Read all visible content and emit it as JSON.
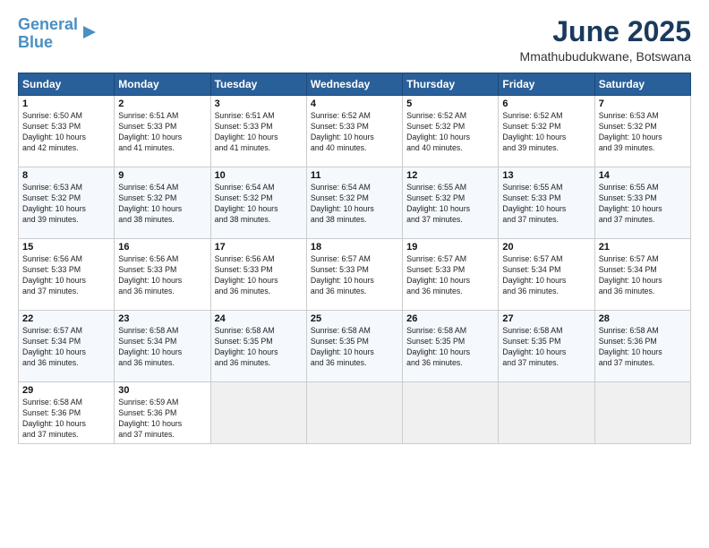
{
  "logo": {
    "line1": "General",
    "line2": "Blue"
  },
  "title": "June 2025",
  "subtitle": "Mmathubudukwane, Botswana",
  "headers": [
    "Sunday",
    "Monday",
    "Tuesday",
    "Wednesday",
    "Thursday",
    "Friday",
    "Saturday"
  ],
  "weeks": [
    [
      {
        "day": "1",
        "info": "Sunrise: 6:50 AM\nSunset: 5:33 PM\nDaylight: 10 hours\nand 42 minutes."
      },
      {
        "day": "2",
        "info": "Sunrise: 6:51 AM\nSunset: 5:33 PM\nDaylight: 10 hours\nand 41 minutes."
      },
      {
        "day": "3",
        "info": "Sunrise: 6:51 AM\nSunset: 5:33 PM\nDaylight: 10 hours\nand 41 minutes."
      },
      {
        "day": "4",
        "info": "Sunrise: 6:52 AM\nSunset: 5:33 PM\nDaylight: 10 hours\nand 40 minutes."
      },
      {
        "day": "5",
        "info": "Sunrise: 6:52 AM\nSunset: 5:32 PM\nDaylight: 10 hours\nand 40 minutes."
      },
      {
        "day": "6",
        "info": "Sunrise: 6:52 AM\nSunset: 5:32 PM\nDaylight: 10 hours\nand 39 minutes."
      },
      {
        "day": "7",
        "info": "Sunrise: 6:53 AM\nSunset: 5:32 PM\nDaylight: 10 hours\nand 39 minutes."
      }
    ],
    [
      {
        "day": "8",
        "info": "Sunrise: 6:53 AM\nSunset: 5:32 PM\nDaylight: 10 hours\nand 39 minutes."
      },
      {
        "day": "9",
        "info": "Sunrise: 6:54 AM\nSunset: 5:32 PM\nDaylight: 10 hours\nand 38 minutes."
      },
      {
        "day": "10",
        "info": "Sunrise: 6:54 AM\nSunset: 5:32 PM\nDaylight: 10 hours\nand 38 minutes."
      },
      {
        "day": "11",
        "info": "Sunrise: 6:54 AM\nSunset: 5:32 PM\nDaylight: 10 hours\nand 38 minutes."
      },
      {
        "day": "12",
        "info": "Sunrise: 6:55 AM\nSunset: 5:32 PM\nDaylight: 10 hours\nand 37 minutes."
      },
      {
        "day": "13",
        "info": "Sunrise: 6:55 AM\nSunset: 5:33 PM\nDaylight: 10 hours\nand 37 minutes."
      },
      {
        "day": "14",
        "info": "Sunrise: 6:55 AM\nSunset: 5:33 PM\nDaylight: 10 hours\nand 37 minutes."
      }
    ],
    [
      {
        "day": "15",
        "info": "Sunrise: 6:56 AM\nSunset: 5:33 PM\nDaylight: 10 hours\nand 37 minutes."
      },
      {
        "day": "16",
        "info": "Sunrise: 6:56 AM\nSunset: 5:33 PM\nDaylight: 10 hours\nand 36 minutes."
      },
      {
        "day": "17",
        "info": "Sunrise: 6:56 AM\nSunset: 5:33 PM\nDaylight: 10 hours\nand 36 minutes."
      },
      {
        "day": "18",
        "info": "Sunrise: 6:57 AM\nSunset: 5:33 PM\nDaylight: 10 hours\nand 36 minutes."
      },
      {
        "day": "19",
        "info": "Sunrise: 6:57 AM\nSunset: 5:33 PM\nDaylight: 10 hours\nand 36 minutes."
      },
      {
        "day": "20",
        "info": "Sunrise: 6:57 AM\nSunset: 5:34 PM\nDaylight: 10 hours\nand 36 minutes."
      },
      {
        "day": "21",
        "info": "Sunrise: 6:57 AM\nSunset: 5:34 PM\nDaylight: 10 hours\nand 36 minutes."
      }
    ],
    [
      {
        "day": "22",
        "info": "Sunrise: 6:57 AM\nSunset: 5:34 PM\nDaylight: 10 hours\nand 36 minutes."
      },
      {
        "day": "23",
        "info": "Sunrise: 6:58 AM\nSunset: 5:34 PM\nDaylight: 10 hours\nand 36 minutes."
      },
      {
        "day": "24",
        "info": "Sunrise: 6:58 AM\nSunset: 5:35 PM\nDaylight: 10 hours\nand 36 minutes."
      },
      {
        "day": "25",
        "info": "Sunrise: 6:58 AM\nSunset: 5:35 PM\nDaylight: 10 hours\nand 36 minutes."
      },
      {
        "day": "26",
        "info": "Sunrise: 6:58 AM\nSunset: 5:35 PM\nDaylight: 10 hours\nand 36 minutes."
      },
      {
        "day": "27",
        "info": "Sunrise: 6:58 AM\nSunset: 5:35 PM\nDaylight: 10 hours\nand 37 minutes."
      },
      {
        "day": "28",
        "info": "Sunrise: 6:58 AM\nSunset: 5:36 PM\nDaylight: 10 hours\nand 37 minutes."
      }
    ],
    [
      {
        "day": "29",
        "info": "Sunrise: 6:58 AM\nSunset: 5:36 PM\nDaylight: 10 hours\nand 37 minutes."
      },
      {
        "day": "30",
        "info": "Sunrise: 6:59 AM\nSunset: 5:36 PM\nDaylight: 10 hours\nand 37 minutes."
      },
      {
        "day": "",
        "info": ""
      },
      {
        "day": "",
        "info": ""
      },
      {
        "day": "",
        "info": ""
      },
      {
        "day": "",
        "info": ""
      },
      {
        "day": "",
        "info": ""
      }
    ]
  ]
}
